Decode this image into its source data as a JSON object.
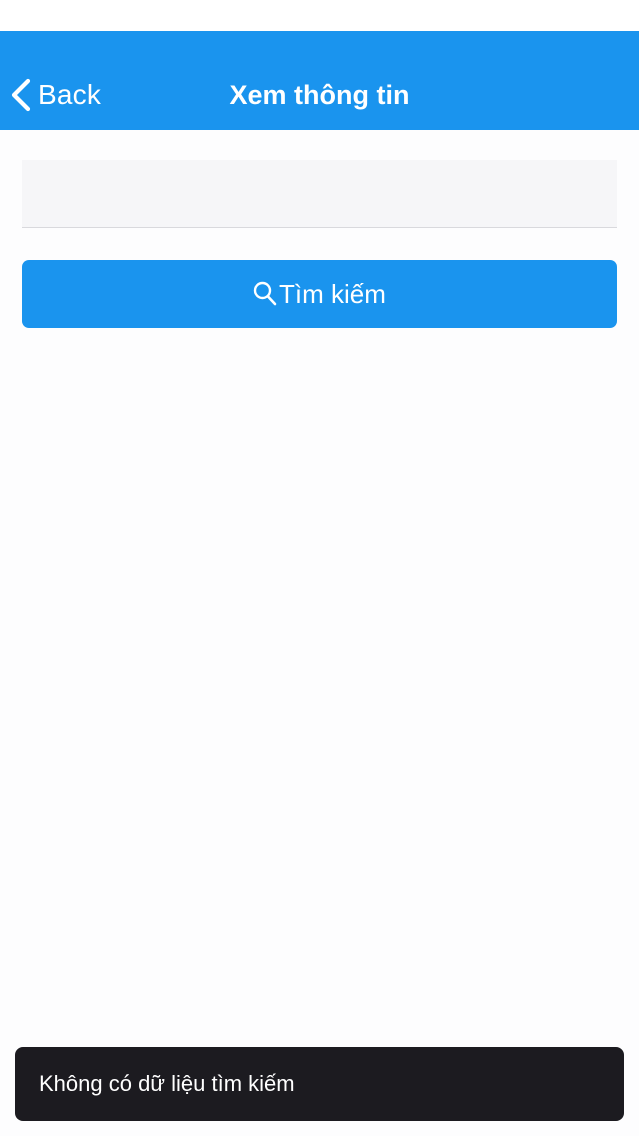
{
  "nav": {
    "back_label": "Back",
    "title": "Xem thông tin",
    "background_color": "#1a94ee",
    "back_icon": "chevron-left-icon"
  },
  "search": {
    "input_value": "",
    "placeholder": "",
    "button_label": "Tìm kiếm",
    "button_icon": "search-icon",
    "button_color": "#1a94ee"
  },
  "toast": {
    "message": "Không có dữ liệu tìm kiếm",
    "background_color": "#1c1b20"
  }
}
